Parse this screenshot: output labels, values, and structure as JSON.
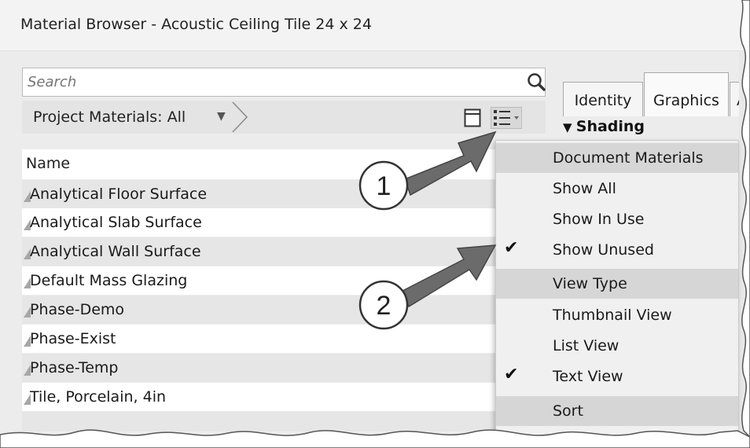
{
  "window": {
    "title": "Material Browser - Acoustic Ceiling Tile 24 x 24"
  },
  "search": {
    "placeholder": "Search"
  },
  "filter": {
    "label": "Project Materials: All"
  },
  "list": {
    "header": "Name",
    "items": [
      "Analytical Floor Surface",
      "Analytical Slab Surface",
      "Analytical Wall Surface",
      "Default Mass Glazing",
      "Phase-Demo",
      "Phase-Exist",
      "Phase-Temp",
      "Tile, Porcelain, 4in"
    ]
  },
  "tabs": [
    "Identity",
    "Graphics",
    "A"
  ],
  "section": {
    "shading": "Shading"
  },
  "menu": {
    "items": [
      {
        "label": "Document Materials",
        "header": true,
        "checked": false
      },
      {
        "label": "Show All",
        "header": false,
        "checked": false
      },
      {
        "label": "Show In Use",
        "header": false,
        "checked": false
      },
      {
        "label": "Show Unused",
        "header": false,
        "checked": true
      },
      {
        "label": "View Type",
        "header": true,
        "checked": false
      },
      {
        "label": "Thumbnail View",
        "header": false,
        "checked": false
      },
      {
        "label": "List View",
        "header": false,
        "checked": false
      },
      {
        "label": "Text View",
        "header": false,
        "checked": true
      },
      {
        "label": "Sort",
        "header": true,
        "checked": false
      }
    ]
  },
  "callouts": [
    "1",
    "2"
  ],
  "icons": {
    "search": "search-icon",
    "thumbnail": "thumbnail-view-icon",
    "list": "list-view-icon",
    "dropdown": "dropdown-arrow-icon",
    "material": "material-icon",
    "check": "checkmark-icon"
  },
  "colors": {
    "header_bg": "#d6d6d6",
    "row_alt": "#e6e6e6",
    "callout_arrow": "#6b6b6b"
  }
}
